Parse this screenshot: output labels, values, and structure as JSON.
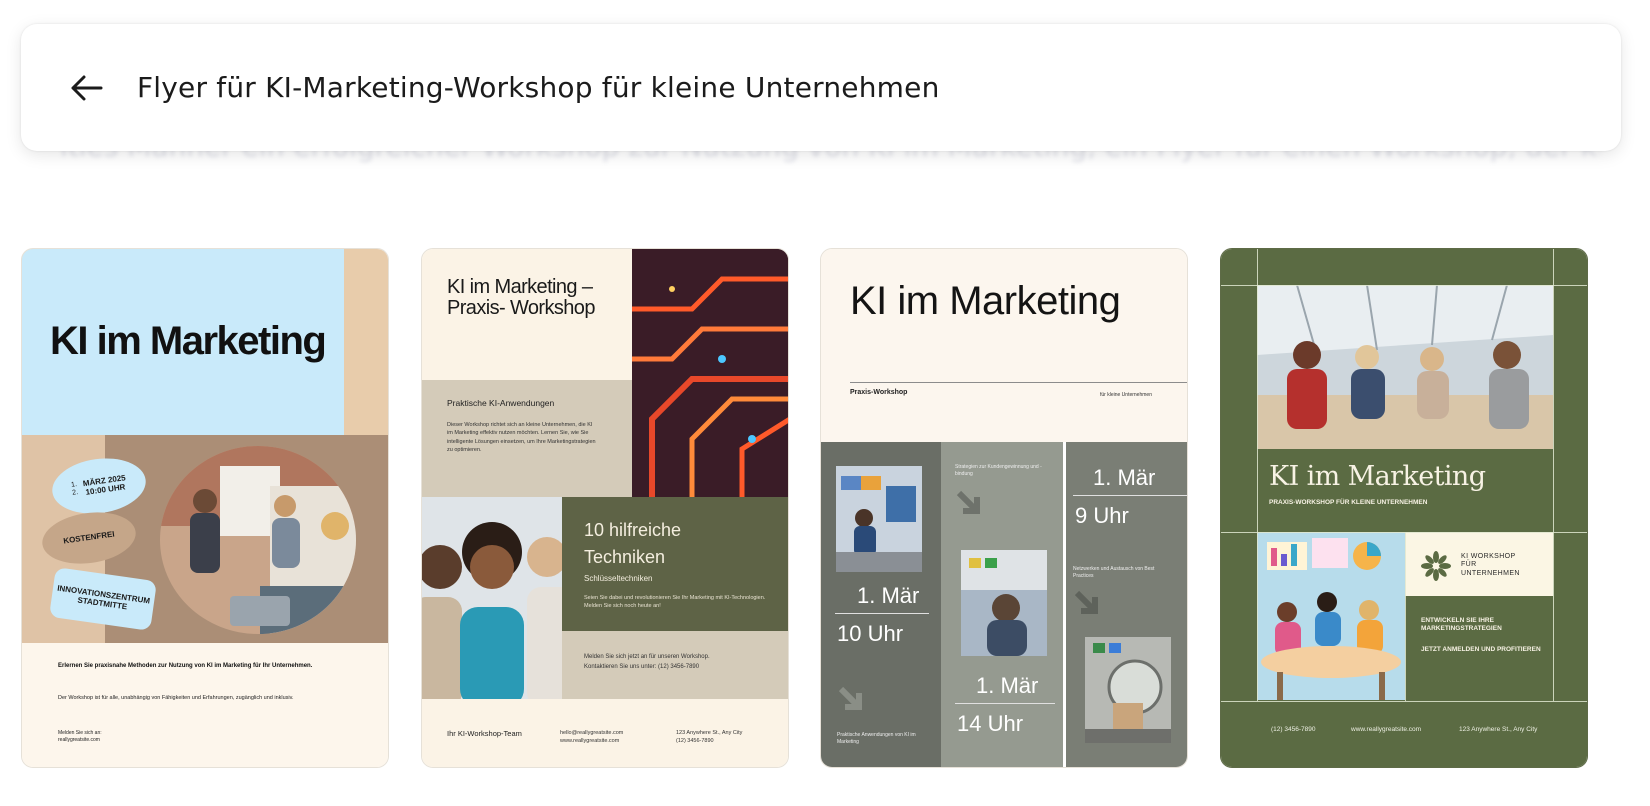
{
  "search": {
    "query": "Flyer für KI-Marketing-Workshop für kleine Unternehmen",
    "ghost_text": "ities Manner ein erfolgreicher Workshop zur Nutzung von KI im Marketing, ein Flyer für einen Workshop, der kleinen Unternehmen zeigt"
  },
  "colors": {
    "card1_blue": "#c9eafa",
    "card1_tan": "#ab8e76",
    "card2_olive": "#5e6346",
    "card3_grey": "#6a6e66",
    "card4_green": "#5b6b43"
  },
  "templates": [
    {
      "title": "KI im Marketing",
      "badge_date": "MÄRZ 2025\n10:00 UHR",
      "badge_date_marks": "1.\n2.",
      "badge_free": "KOSTENFREI",
      "badge_venue": "INNOVATIONSZENTRUM\nSTADTMITTE",
      "line1": "Erlernen Sie praxisnahe Methoden zur Nutzung von KI im Marketing für Ihr Unternehmen.",
      "line2": "Der Workshop ist für alle, unabhängig von Fähigkeiten und Erfahrungen, zugänglich und inklusiv.",
      "line3": "Melden Sie sich an:\nreallygreatsite.com"
    },
    {
      "title": "KI im Marketing – Praxis- Workshop",
      "section": "Praktische KI-Anwendungen",
      "body": "Dieser Workshop richtet sich an kleine Unternehmen, die KI im Marketing effektiv nutzen möchten. Lernen Sie, wie Sie intelligente Lösungen einsetzen, um Ihre Marketingstrategien zu optimieren.",
      "highlight_title": "10 hilfreiche Techniken",
      "highlight_sub": "Schlüsseltechniken",
      "highlight_body": "Seien Sie dabei und revolutionieren Sie Ihr Marketing mit KI-Technologien. Melden Sie sich noch heute an!",
      "signup": "Melden Sie sich jetzt an für unseren Workshop.\nKontaktieren Sie uns unter: (12) 3456-7890",
      "footer_team": "Ihr KI-Workshop-Team",
      "footer_contact": "hello@reallygreatsite.com\nwww.reallygreatsite.com",
      "footer_address": "123 Anywhere St., Any City\n(12) 3456-7890"
    },
    {
      "title": "KI im Marketing",
      "label_left": "Praxis-Workshop",
      "label_right": "für kleine Unternehmen",
      "date1": "1. Mär",
      "time1": "10 Uhr",
      "date2": "1. Mär",
      "time2": "14 Uhr",
      "date3": "1. Mär",
      "time3": "9 Uhr",
      "note1": "Strategien zur Kundengewinnung und -bindung",
      "note2": "Netzwerken und Austausch von Best Practices",
      "note3": "Praktische Anwendungen von KI im Marketing"
    },
    {
      "title": "KI im Marketing",
      "subtitle": "PRAXIS-WORKSHOP FÜR KLEINE UNTERNEHMEN",
      "brand": "KI WORKSHOP\nFÜR\nUNTERNEHMEN",
      "cta1": "ENTWICKELN SIE IHRE MARKETINGSTRATEGIEN",
      "cta2": "JETZT ANMELDEN UND PROFITIEREN",
      "phone": "(12) 3456-7890",
      "website": "www.reallygreatsite.com",
      "address": "123 Anywhere St., Any City"
    }
  ]
}
